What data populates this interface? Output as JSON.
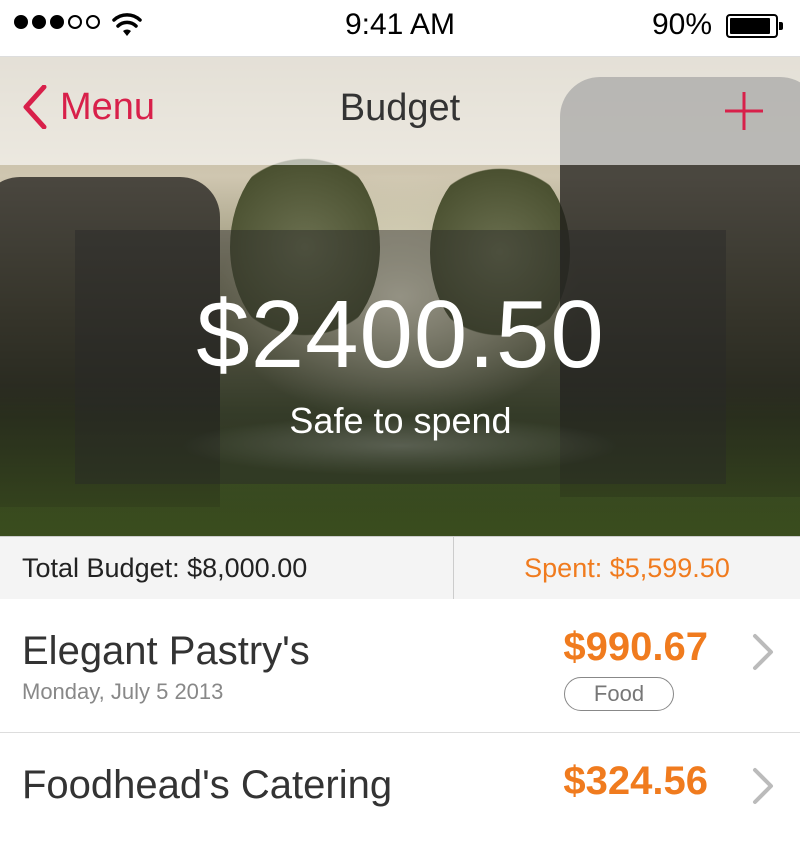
{
  "status_bar": {
    "time": "9:41 AM",
    "battery_percent": "90%",
    "signal_bars_filled": 3,
    "signal_bars_total": 5,
    "battery_level": 0.9
  },
  "nav": {
    "back_label": "Menu",
    "title": "Budget",
    "back_icon": "chevron-left-icon",
    "add_icon": "plus-icon"
  },
  "summary": {
    "amount": "$2400.50",
    "caption": "Safe to spend"
  },
  "totals": {
    "total_budget": "Total Budget: $8,000.00",
    "spent": "Spent: $5,599.50"
  },
  "expenses": [
    {
      "vendor": "Elegant Pastry's",
      "date": "Monday, July 5 2013",
      "amount": "$990.67",
      "category": "Food"
    },
    {
      "vendor": "Foodhead's Catering",
      "amount": "$324.56"
    }
  ],
  "colors": {
    "accent": "#d8204a",
    "orange": "#f07b1e"
  }
}
